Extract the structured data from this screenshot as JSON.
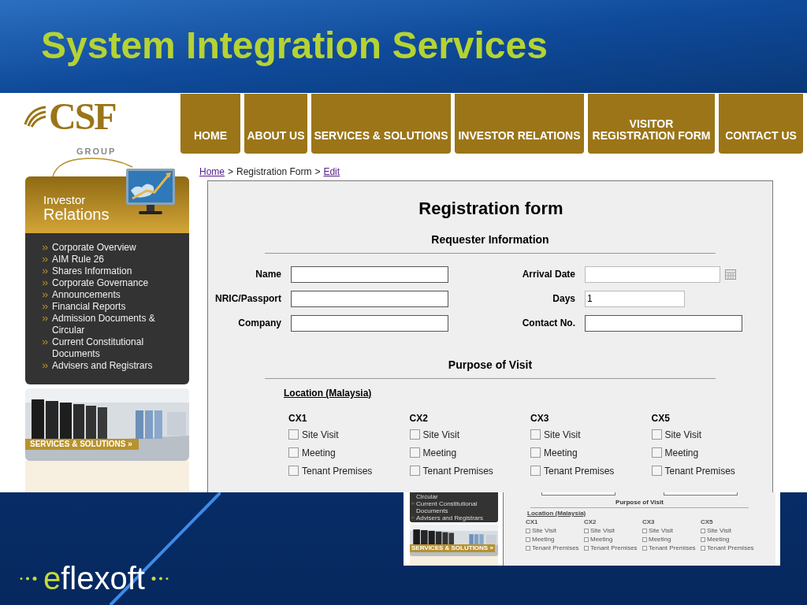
{
  "slide": {
    "title": "System Integration Services",
    "footer_logo": "eflexoft"
  },
  "website": {
    "logo": {
      "letters": "CSF",
      "tagline": "GROUP"
    },
    "nav": [
      {
        "lines": [
          "HOME"
        ]
      },
      {
        "lines": [
          "ABOUT US"
        ]
      },
      {
        "lines": [
          "SERVICES & SOLUTIONS"
        ]
      },
      {
        "lines": [
          "INVESTOR RELATIONS"
        ]
      },
      {
        "lines": [
          "VISITOR",
          "REGISTRATION FORM"
        ]
      },
      {
        "lines": [
          "CONTACT US"
        ]
      }
    ],
    "breadcrumb": [
      {
        "label": "Home",
        "link": true
      },
      {
        "label": ">",
        "link": false
      },
      {
        "label": "Registration Form",
        "link": false
      },
      {
        "label": ">",
        "link": false
      },
      {
        "label": "Edit",
        "link": true
      }
    ],
    "sidebar": {
      "heading_lines": [
        "Investor",
        "Relations"
      ],
      "items": [
        {
          "label": "Corporate Overview"
        },
        {
          "label": "AIM Rule 26"
        },
        {
          "label": "Shares Information"
        },
        {
          "label": "Corporate Governance"
        },
        {
          "label": "Announcements"
        },
        {
          "label": "Financial Reports"
        },
        {
          "label": "Admission Documents & Circular"
        },
        {
          "label": "Current Constitutional Documents"
        },
        {
          "label": "Advisers and Registrars"
        }
      ],
      "banner": "SERVICES & SOLUTIONS »"
    },
    "form": {
      "title": "Registration form",
      "requester_heading": "Requester Information",
      "rows": [
        [
          {
            "label": "Name",
            "kind": "text"
          },
          {
            "label": "Arrival Date",
            "kind": "date"
          }
        ],
        [
          {
            "label": "NRIC/Passport",
            "kind": "text"
          },
          {
            "label": "Days",
            "kind": "short",
            "value": "1"
          }
        ],
        [
          {
            "label": "Company",
            "kind": "text"
          },
          {
            "label": "Contact No.",
            "kind": "wide"
          }
        ]
      ],
      "purpose_heading": "Purpose of Visit",
      "location_heading": "Location (Malaysia)",
      "locations": [
        {
          "name": "CX1",
          "options": [
            {
              "label": "Site Visit",
              "checked": false
            },
            {
              "label": "Meeting",
              "checked": false
            },
            {
              "label": "Tenant Premises",
              "checked": false
            }
          ]
        },
        {
          "name": "CX2",
          "options": [
            {
              "label": "Site Visit",
              "checked": false
            },
            {
              "label": "Meeting",
              "checked": false
            },
            {
              "label": "Tenant Premises",
              "checked": false
            }
          ]
        },
        {
          "name": "CX3",
          "options": [
            {
              "label": "Site Visit",
              "checked": false
            },
            {
              "label": "Meeting",
              "checked": false
            },
            {
              "label": "Tenant Premises",
              "checked": false
            }
          ]
        },
        {
          "name": "CX5",
          "options": [
            {
              "label": "Site Visit",
              "checked": false
            },
            {
              "label": "Meeting",
              "checked": false
            },
            {
              "label": "Tenant Premises",
              "checked": false
            }
          ]
        }
      ]
    }
  },
  "preview": {
    "sidebar_items": [
      {
        "label": "Circular",
        "marker": false
      },
      {
        "label": "Current Constitutional Documents",
        "marker": true
      },
      {
        "label": "Advisers and Registrars",
        "marker": true
      }
    ],
    "banner": "SERVICES & SOLUTIONS »",
    "purpose_heading": "Purpose of Visit",
    "location_heading": "Location (Malaysia)",
    "locations": [
      {
        "name": "CX1",
        "options": [
          {
            "label": "Site Visit",
            "checked": false
          },
          {
            "label": "Meeting",
            "checked": false
          },
          {
            "label": "Tenant Premises",
            "checked": false
          }
        ]
      },
      {
        "name": "CX2",
        "options": [
          {
            "label": "Site Visit",
            "checked": false
          },
          {
            "label": "Meeting",
            "checked": false
          },
          {
            "label": "Tenant Premises",
            "checked": false
          }
        ]
      },
      {
        "name": "CX3",
        "options": [
          {
            "label": "Site Visit",
            "checked": false
          },
          {
            "label": "Meeting",
            "checked": false
          },
          {
            "label": "Tenant Premises",
            "checked": false
          }
        ]
      },
      {
        "name": "CX5",
        "options": [
          {
            "label": "Site Visit",
            "checked": false
          },
          {
            "label": "Meeting",
            "checked": false
          },
          {
            "label": "Tenant Premises",
            "checked": false
          }
        ]
      }
    ]
  }
}
